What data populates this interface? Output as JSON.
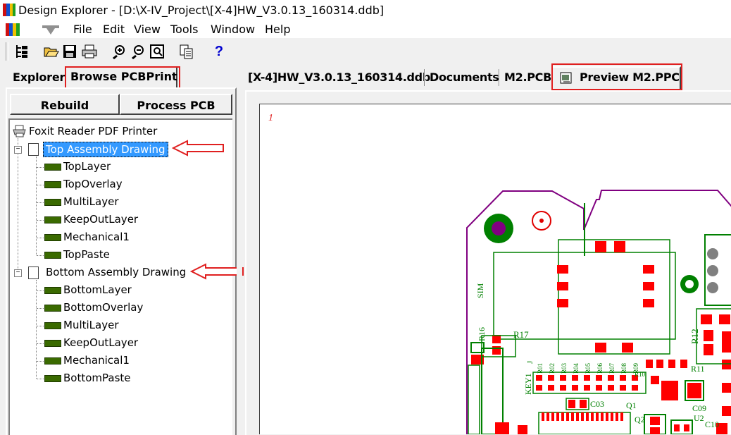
{
  "window": {
    "title": "Design Explorer - [D:\\X-IV_Project\\[X-4]HW_V3.0.13_160314.ddb]"
  },
  "menu": {
    "items": [
      {
        "label": "File"
      },
      {
        "label": "Edit"
      },
      {
        "label": "View"
      },
      {
        "label": "Tools"
      },
      {
        "label": "Window"
      },
      {
        "label": "Help"
      }
    ]
  },
  "toolbar": {
    "icons": [
      "tree-toggle-icon",
      "open-folder-icon",
      "save-icon",
      "print-icon",
      "zoom-in-icon",
      "zoom-out-icon",
      "zoom-fit-icon",
      "copy-icon",
      "help-icon"
    ],
    "help_label": "?"
  },
  "left": {
    "tabs": [
      {
        "label": "Explorer"
      },
      {
        "label": "Browse PCBPrint"
      }
    ],
    "buttons": {
      "rebuild": "Rebuild",
      "process": "Process PCB"
    },
    "printer": "Foxit Reader PDF Printer",
    "groups": [
      {
        "label": "Top Assembly Drawing",
        "layers": [
          "TopLayer",
          "TopOverlay",
          "MultiLayer",
          "KeepOutLayer",
          "Mechanical1",
          "TopPaste"
        ]
      },
      {
        "label": "Bottom Assembly Drawing",
        "layers": [
          "BottomLayer",
          "BottomOverlay",
          "MultiLayer",
          "KeepOutLayer",
          "Mechanical1",
          "BottomPaste"
        ]
      }
    ]
  },
  "right": {
    "tabs": [
      {
        "label": "[X-4]HW_V3.0.13_160314.ddb"
      },
      {
        "label": "Documents"
      },
      {
        "label": "M2.PCB"
      },
      {
        "label": "Preview M2.PPC"
      }
    ],
    "page_number": "1"
  },
  "pcb": {
    "silk": {
      "sim": "SIM",
      "r16": "R16",
      "r17": "R17",
      "r12": "R12",
      "r11": "R11",
      "r10": "R10",
      "key1": "KEY1",
      "c03": "C03",
      "c09": "C09",
      "c10": "C10",
      "q1": "Q1",
      "q2": "Q2",
      "u2": "U2",
      "r01": "R01",
      "r02": "R02",
      "r03": "R03",
      "r04": "R04",
      "r05": "R05",
      "r06": "R06",
      "r07": "R07",
      "r08": "R08",
      "r09": "R09",
      "j": "J"
    },
    "colors": {
      "outline": "#800080",
      "overlay": "#008000",
      "pad": "#ff0000",
      "via": "#808080"
    }
  },
  "colors": {
    "highlight": "#e02020",
    "selection": "#3399ff"
  }
}
